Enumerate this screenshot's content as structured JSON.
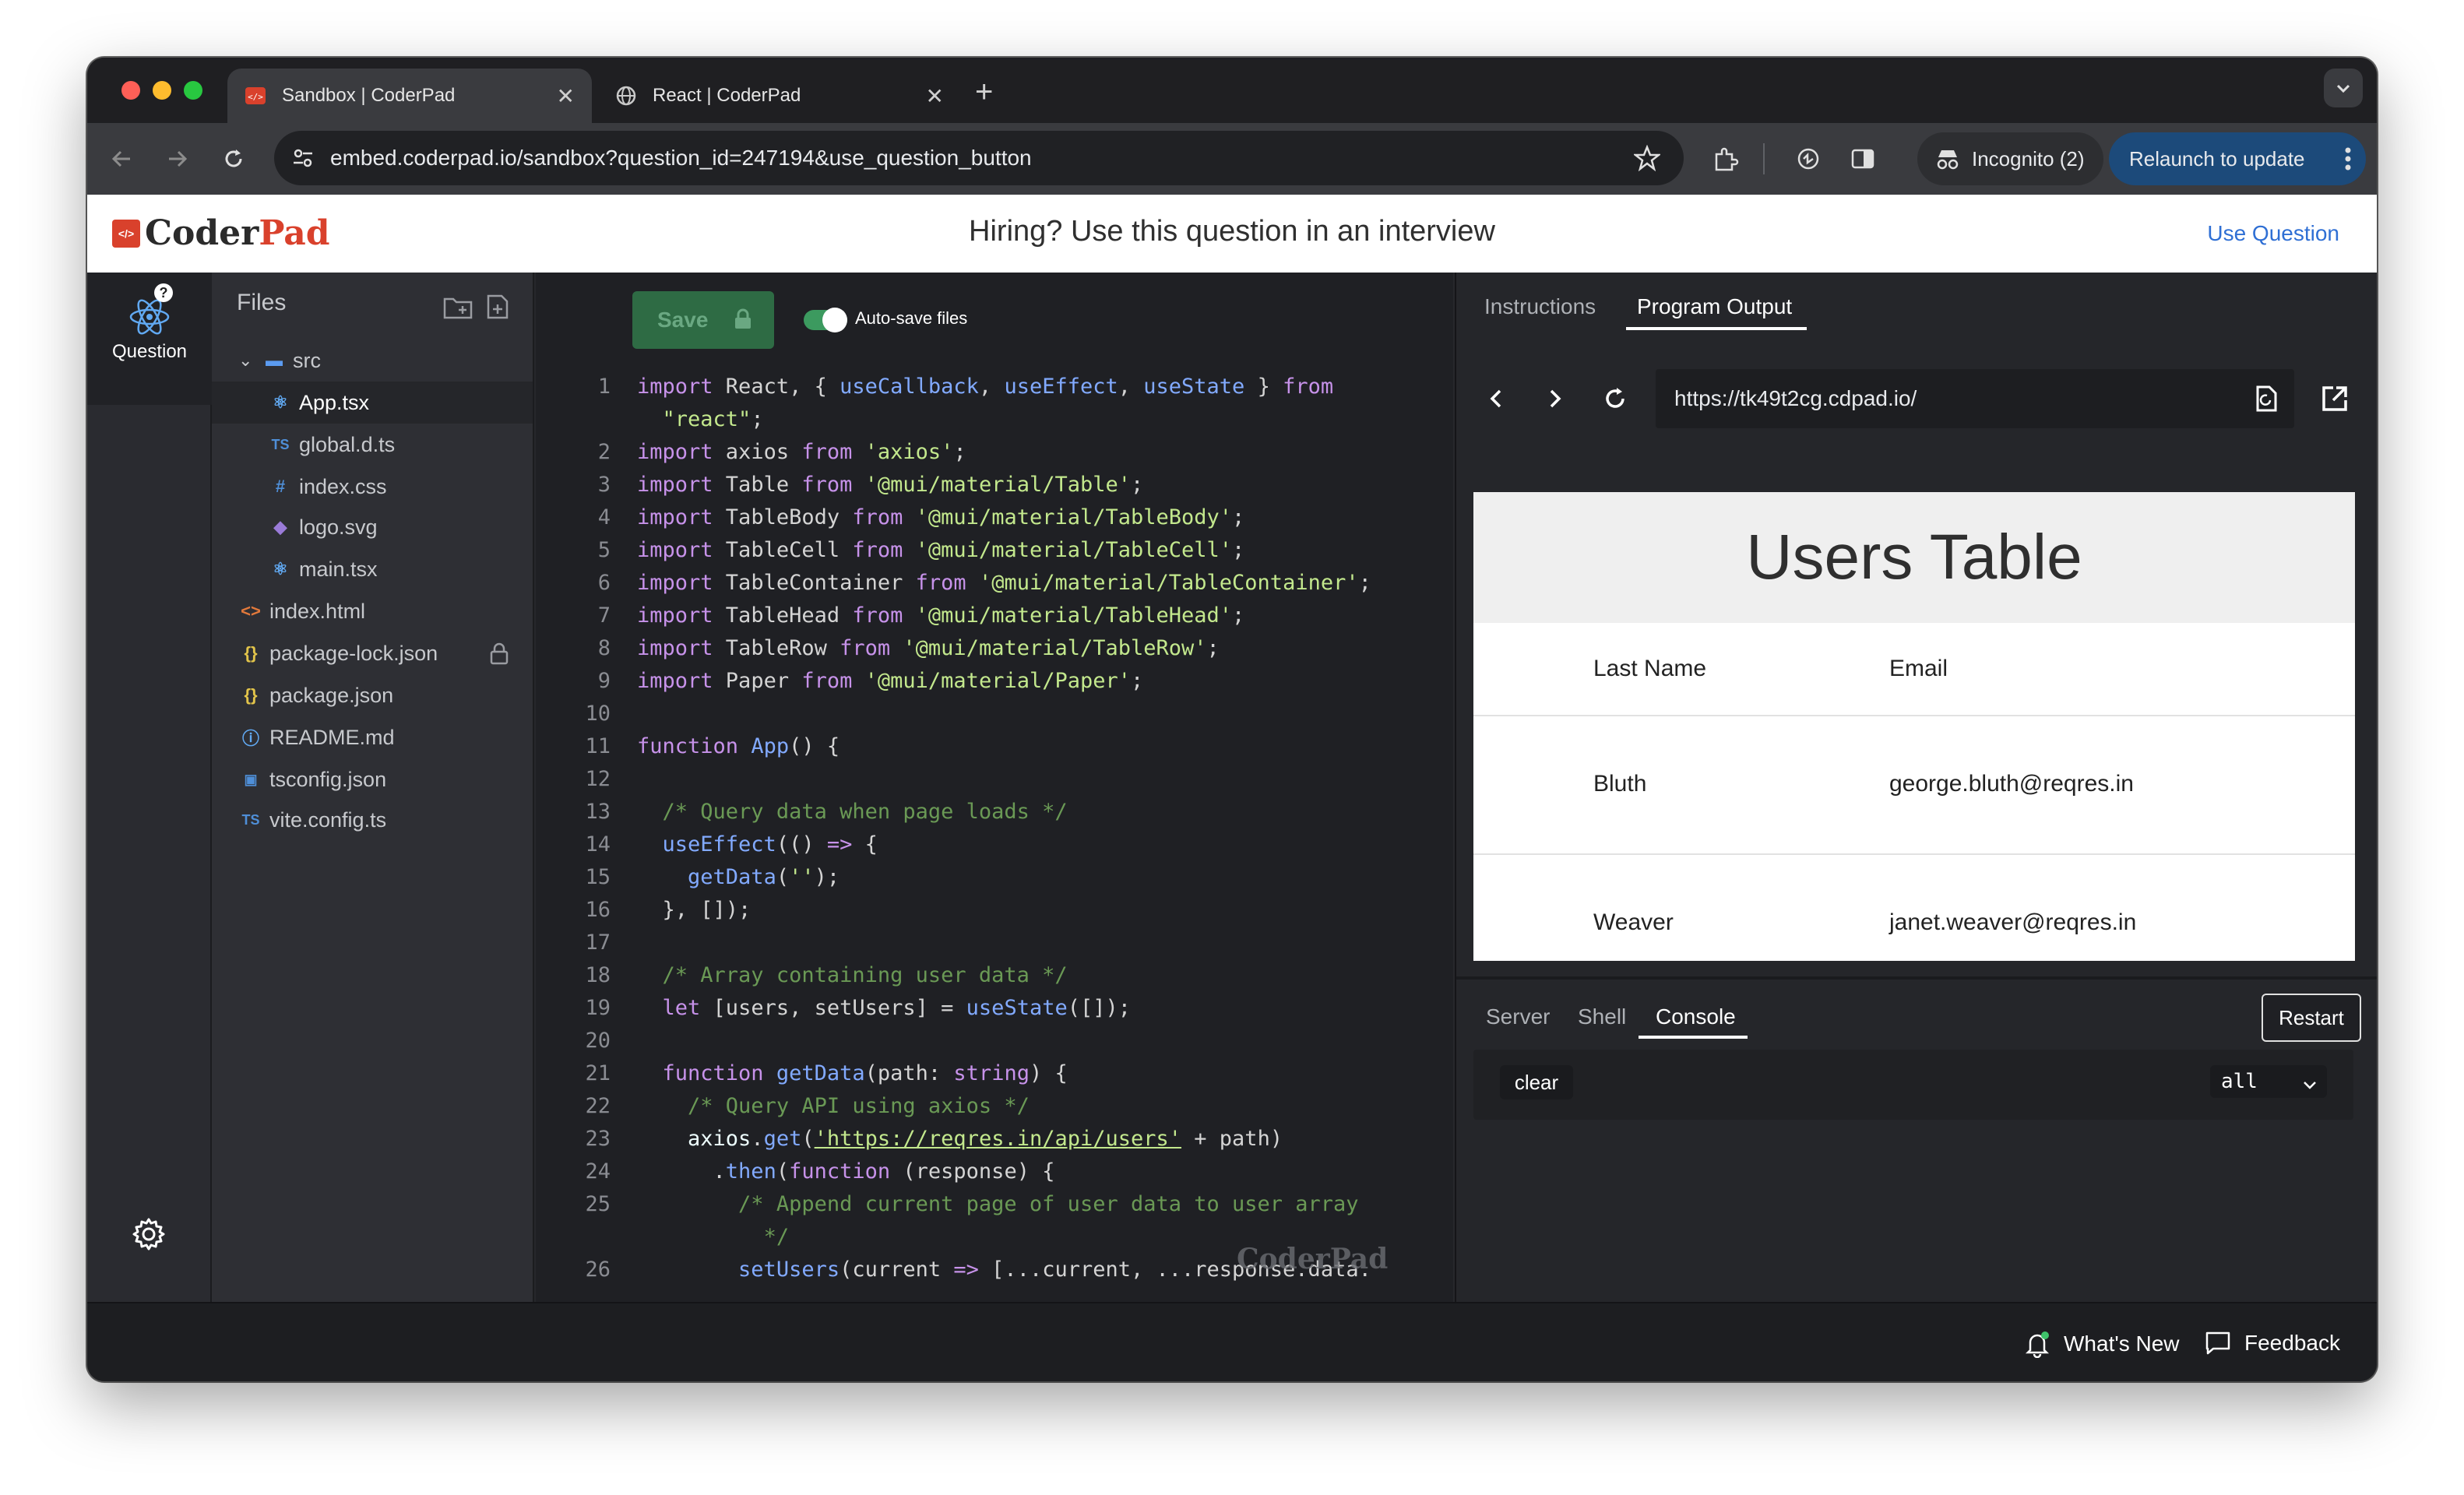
{
  "browser": {
    "tabs": [
      {
        "label": "Sandbox | CoderPad",
        "active": true
      },
      {
        "label": "React | CoderPad",
        "active": false
      }
    ],
    "url": "embed.coderpad.io/sandbox?question_id=247194&use_question_button",
    "incognito_label": "Incognito (2)",
    "relaunch_label": "Relaunch to update"
  },
  "header": {
    "logo_prefix": "Coder",
    "logo_suffix": "Pad",
    "logo_mark": "</>",
    "tagline": "Hiring? Use this question in an interview",
    "use_question": "Use Question"
  },
  "rail": {
    "question_label": "Question",
    "question_badge": "?"
  },
  "files": {
    "title": "Files",
    "items": [
      {
        "name": "src",
        "icon": "folder-icon",
        "indent": 0
      },
      {
        "name": "App.tsx",
        "icon": "react-icon",
        "indent": 1
      },
      {
        "name": "global.d.ts",
        "icon": "ts-icon",
        "indent": 1
      },
      {
        "name": "index.css",
        "icon": "css-icon",
        "indent": 1
      },
      {
        "name": "logo.svg",
        "icon": "svg-icon",
        "indent": 1
      },
      {
        "name": "main.tsx",
        "icon": "react-icon",
        "indent": 1
      },
      {
        "name": "index.html",
        "icon": "html-icon",
        "indent": 0
      },
      {
        "name": "package-lock.json",
        "icon": "json-icon",
        "indent": 0
      },
      {
        "name": "package.json",
        "icon": "json-icon",
        "indent": 0
      },
      {
        "name": "README.md",
        "icon": "info-icon",
        "indent": 0
      },
      {
        "name": "tsconfig.json",
        "icon": "ts-config-icon",
        "indent": 0
      },
      {
        "name": "vite.config.ts",
        "icon": "ts-icon",
        "indent": 0
      }
    ]
  },
  "editor": {
    "save_label": "Save",
    "autosave_label": "Auto-save files",
    "watermark": "CoderPad"
  },
  "output": {
    "tabs": [
      "Instructions",
      "Program Output"
    ],
    "preview_url": "https://tk49t2cg.cdpad.io/",
    "preview_title": "Users Table",
    "columns": [
      "Last Name",
      "Email"
    ],
    "rows": [
      [
        "Bluth",
        "george.bluth@reqres.in"
      ],
      [
        "Weaver",
        "janet.weaver@reqres.in"
      ]
    ]
  },
  "console": {
    "tabs": [
      "Server",
      "Shell",
      "Console"
    ],
    "restart_label": "Restart",
    "clear_label": "clear",
    "filter_value": "all"
  },
  "footer": {
    "whats_new": "What's New",
    "feedback": "Feedback"
  }
}
